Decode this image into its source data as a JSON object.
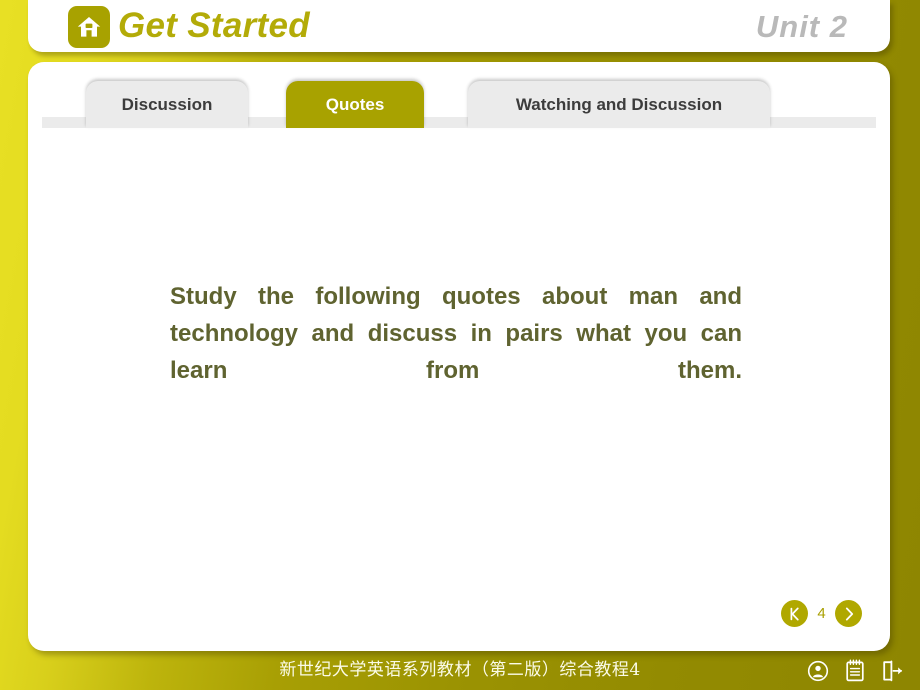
{
  "header": {
    "home_icon": "home-icon",
    "title": "Get Started",
    "unit_label": "Unit  2"
  },
  "tabs": [
    {
      "label": "Discussion",
      "active": false
    },
    {
      "label": "Quotes",
      "active": true
    },
    {
      "label": "Watching and Discussion",
      "active": false
    }
  ],
  "main": {
    "instruction": "Study the following quotes about man and technology and discuss in pairs what you can learn from them."
  },
  "pager": {
    "prev_icon": "previous-chevron-icon",
    "page_number": "4",
    "next_icon": "next-chevron-icon"
  },
  "footer": {
    "text": "新世纪大学英语系列教材（第二版）综合教程4",
    "icons": [
      {
        "name": "user-icon"
      },
      {
        "name": "notepad-icon"
      },
      {
        "name": "exit-icon"
      }
    ]
  },
  "colors": {
    "accent_olive": "#a8a200",
    "bg_yellow": "#e8e024",
    "bg_olive": "#8e8601",
    "body_text": "#5f6330",
    "title_olive": "#b3ab08",
    "unit_gray": "#b9b9b9",
    "tab_inactive": "#ebebeb"
  }
}
